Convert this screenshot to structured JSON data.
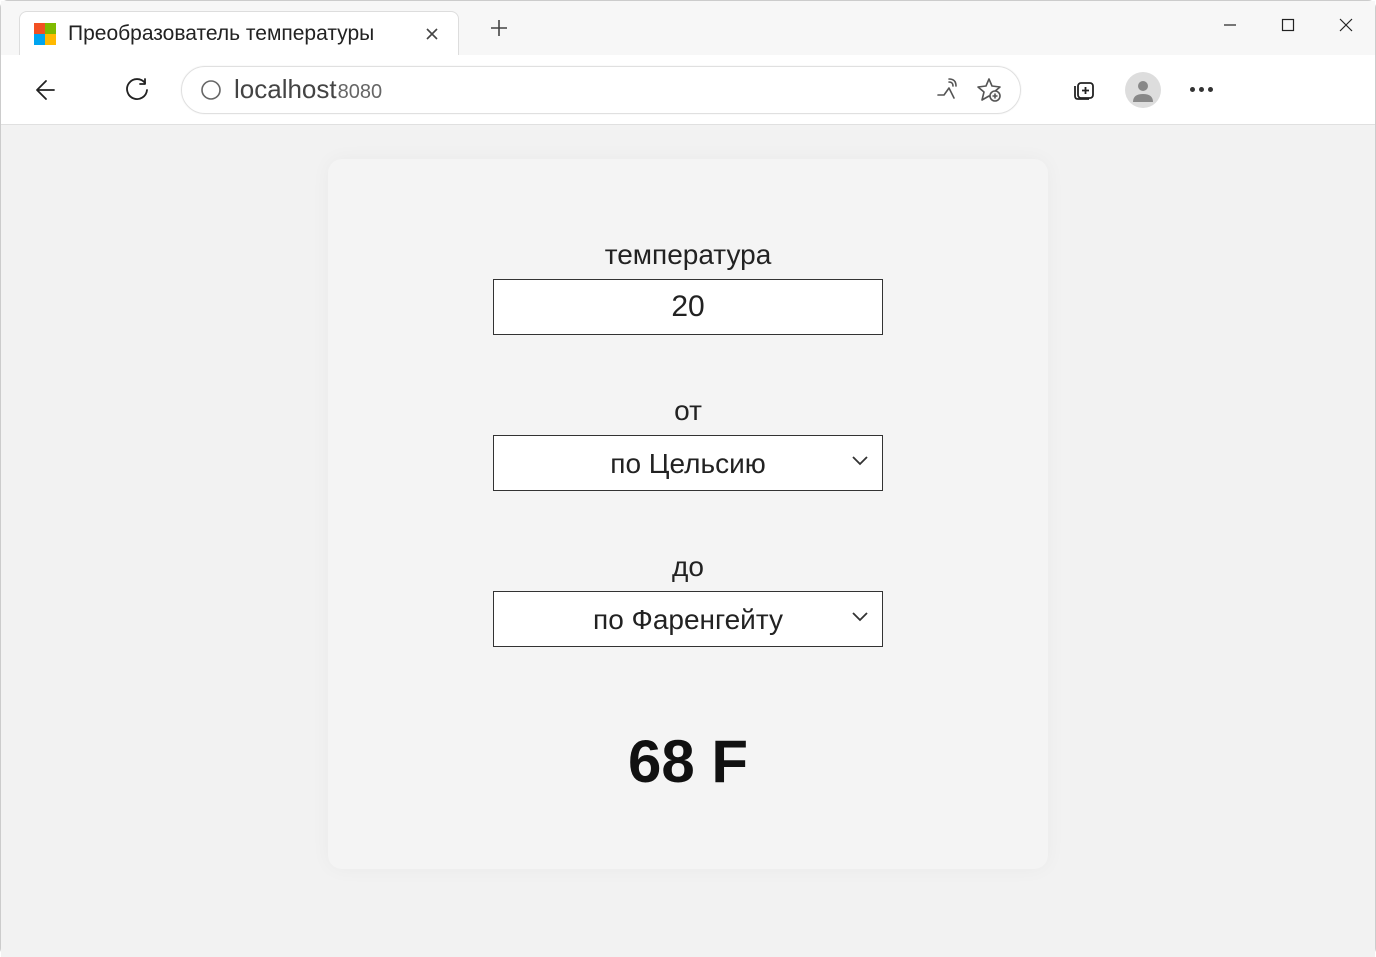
{
  "browser": {
    "tab_title": "Преобразователь температуры",
    "address_host": "localhost",
    "address_port": "8080"
  },
  "form": {
    "temperature_label": "температура",
    "temperature_value": "20",
    "from_label": "от",
    "from_value": "по Цельсию",
    "to_label": "до",
    "to_value": "по Фаренгейту"
  },
  "result": "68 F"
}
